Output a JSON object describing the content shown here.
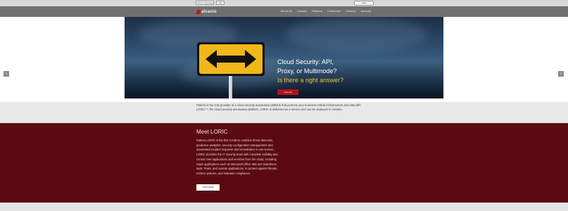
{
  "utility": {
    "language_select": "Select Language",
    "go_label": "Go",
    "login_label": "Login"
  },
  "header": {
    "logo_text": "alcavio",
    "nav": [
      "About Us",
      "Contact",
      "Partners",
      "Customers",
      "Careers",
      "Account"
    ]
  },
  "hero": {
    "title_line1": "Cloud Security: API,",
    "title_line2": "Proxy, or Multimode?",
    "title_line3": "Is there a right answer?",
    "cta_label": "Find Out",
    "prev_label": "‹",
    "next_label": "›",
    "accent_color": "#f2c12e",
    "cta_color": "#b3121c"
  },
  "intro": {
    "text": "Palerra is the only provider of a cloud security automation platform that protects your business-critical infrastructure and data with LORIC™, the cloud security automation platform. LORIC is delivered as a service and can be deployed in minutes."
  },
  "meet": {
    "heading": "Meet LORIC",
    "body": "Palerra LORIC is the first CASB to combine threat detection, predictive analytics, security configuration management and automated incident response and remediation in one service. LORIC provides the IT security team with complete visibility and control over applications and services from the cloud, including SaaS applications such as Microsoft Office 365 and Salesforce, IaaS, PaaS, and custom applications, to protect against threats, enforce policies, and maintain compliance.",
    "cta_label": "Learn More",
    "bg_color": "#5b0a12"
  }
}
